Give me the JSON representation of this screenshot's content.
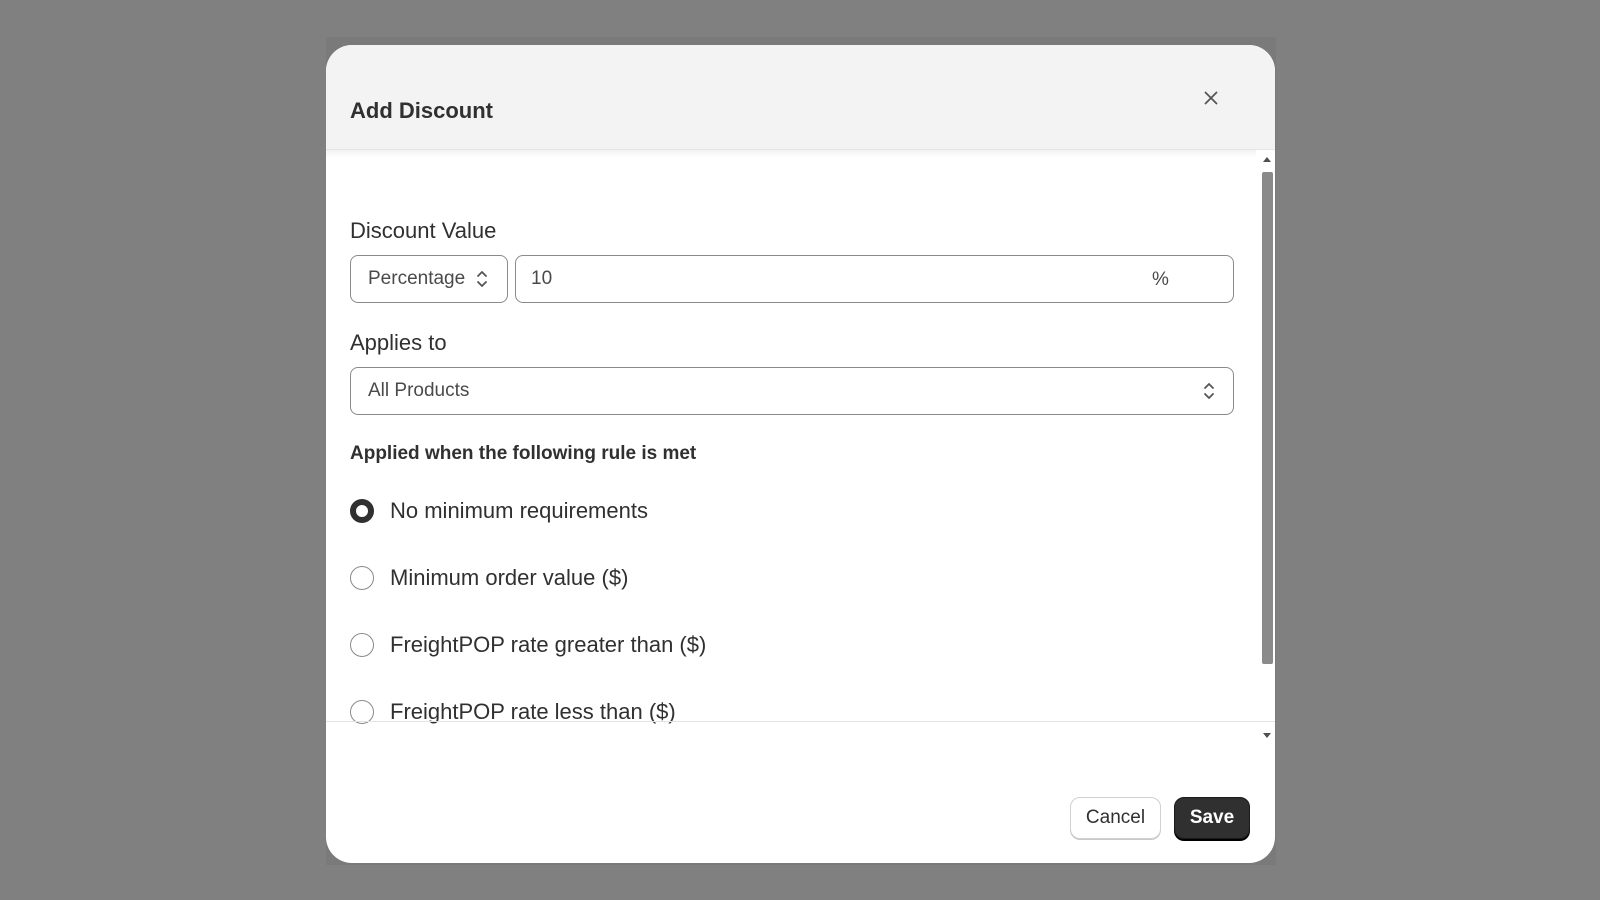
{
  "modal": {
    "title": "Add Discount",
    "close_icon": "close-icon"
  },
  "discount_value": {
    "label": "Discount Value",
    "type_selected": "Percentage",
    "amount": "10",
    "suffix": "%"
  },
  "applies_to": {
    "label": "Applies to",
    "selected": "All Products"
  },
  "rules": {
    "heading": "Applied when the following rule is met",
    "options": [
      {
        "label": "No minimum requirements",
        "checked": true
      },
      {
        "label": "Minimum order value ($)",
        "checked": false
      },
      {
        "label": "FreightPOP rate greater than ($)",
        "checked": false
      },
      {
        "label": "FreightPOP rate less than ($)",
        "checked": false
      }
    ]
  },
  "footer": {
    "cancel_label": "Cancel",
    "save_label": "Save"
  },
  "colors": {
    "primary_button": "#303030",
    "backdrop": "#808080",
    "header_bg": "#f3f3f3"
  }
}
